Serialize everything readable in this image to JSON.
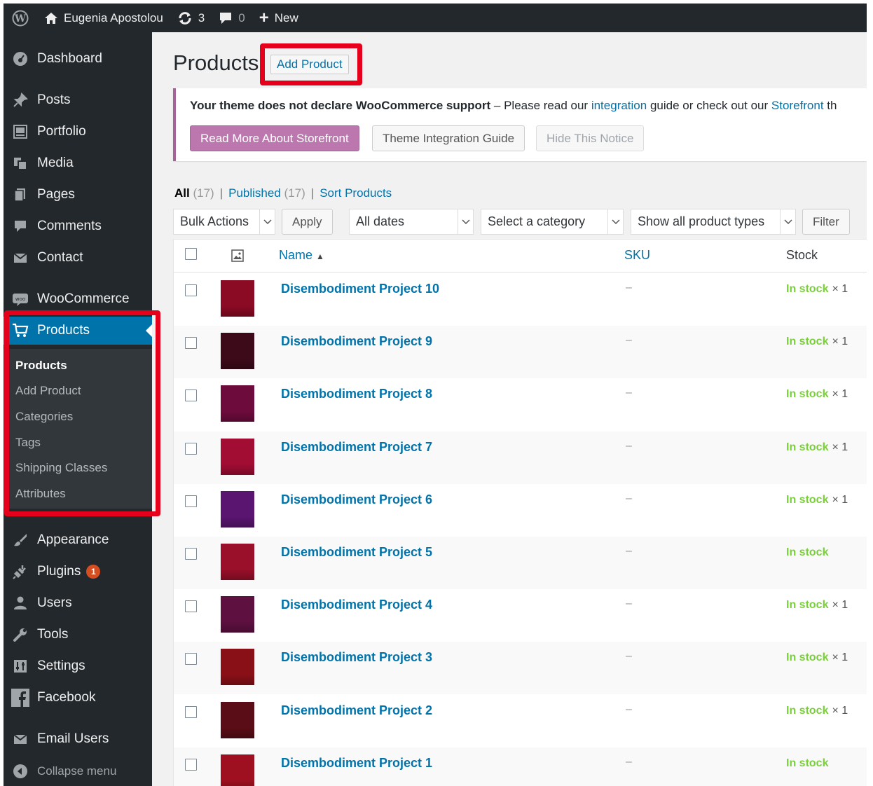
{
  "admin_bar": {
    "site_name": "Eugenia Apostolou",
    "updates_count": "3",
    "comments_count": "0",
    "new_label": "New"
  },
  "sidebar": {
    "items": [
      {
        "label": "Dashboard",
        "icon": "dashboard-icon"
      },
      {
        "label": "Posts",
        "icon": "pin-icon"
      },
      {
        "label": "Portfolio",
        "icon": "portfolio-icon"
      },
      {
        "label": "Media",
        "icon": "media-icon"
      },
      {
        "label": "Pages",
        "icon": "pages-icon"
      },
      {
        "label": "Comments",
        "icon": "comment-icon"
      },
      {
        "label": "Contact",
        "icon": "envelope-icon"
      },
      {
        "label": "WooCommerce",
        "icon": "woo-icon"
      },
      {
        "label": "Products",
        "icon": "cart-icon"
      },
      {
        "label": "Appearance",
        "icon": "brush-icon"
      },
      {
        "label": "Plugins",
        "icon": "plug-icon",
        "badge": "1"
      },
      {
        "label": "Users",
        "icon": "user-icon"
      },
      {
        "label": "Tools",
        "icon": "wrench-icon"
      },
      {
        "label": "Settings",
        "icon": "settings-icon"
      },
      {
        "label": "Facebook",
        "icon": "facebook-icon"
      },
      {
        "label": "Email Users",
        "icon": "envelope-icon"
      }
    ],
    "submenu": [
      "Products",
      "Add Product",
      "Categories",
      "Tags",
      "Shipping Classes",
      "Attributes"
    ],
    "collapse_label": "Collapse menu"
  },
  "main": {
    "title": "Products",
    "add_button": "Add Product",
    "notice": {
      "bold": "Your theme does not declare WooCommerce support",
      "text1": " – Please read our ",
      "link1": "integration",
      "text2": " guide or check out our ",
      "link2": "Storefront",
      "text3": " th",
      "btn_storefront": "Read More About Storefront",
      "btn_guide": "Theme Integration Guide",
      "btn_hide": "Hide This Notice"
    },
    "views": {
      "all": "All",
      "all_count": "(17)",
      "published": "Published",
      "published_count": "(17)",
      "sort": "Sort Products"
    },
    "filters": {
      "bulk": "Bulk Actions",
      "apply": "Apply",
      "dates": "All dates",
      "category": "Select a category",
      "types": "Show all product types",
      "filter": "Filter"
    },
    "columns": {
      "name": "Name",
      "sku": "SKU",
      "stock": "Stock"
    },
    "products": [
      {
        "name": "Disembodiment Project 10",
        "sku": "–",
        "stock": "In stock",
        "qty": "× 1",
        "color": "#8b0a24"
      },
      {
        "name": "Disembodiment Project 9",
        "sku": "–",
        "stock": "In stock",
        "qty": "× 1",
        "color": "#3d0a1a"
      },
      {
        "name": "Disembodiment Project 8",
        "sku": "–",
        "stock": "In stock",
        "qty": "× 1",
        "color": "#6e0b3d"
      },
      {
        "name": "Disembodiment Project 7",
        "sku": "–",
        "stock": "In stock",
        "qty": "× 1",
        "color": "#a10d33"
      },
      {
        "name": "Disembodiment Project 6",
        "sku": "–",
        "stock": "In stock",
        "qty": "× 1",
        "color": "#5a1570"
      },
      {
        "name": "Disembodiment Project 5",
        "sku": "–",
        "stock": "In stock",
        "qty": "",
        "color": "#9a0f2a"
      },
      {
        "name": "Disembodiment Project 4",
        "sku": "–",
        "stock": "In stock",
        "qty": "× 1",
        "color": "#5e1040"
      },
      {
        "name": "Disembodiment Project 3",
        "sku": "–",
        "stock": "In stock",
        "qty": "× 1",
        "color": "#8a1018"
      },
      {
        "name": "Disembodiment Project 2",
        "sku": "–",
        "stock": "In stock",
        "qty": "× 1",
        "color": "#5a0d16"
      },
      {
        "name": "Disembodiment Project 1",
        "sku": "–",
        "stock": "In stock",
        "qty": "",
        "color": "#9e1020"
      }
    ]
  }
}
